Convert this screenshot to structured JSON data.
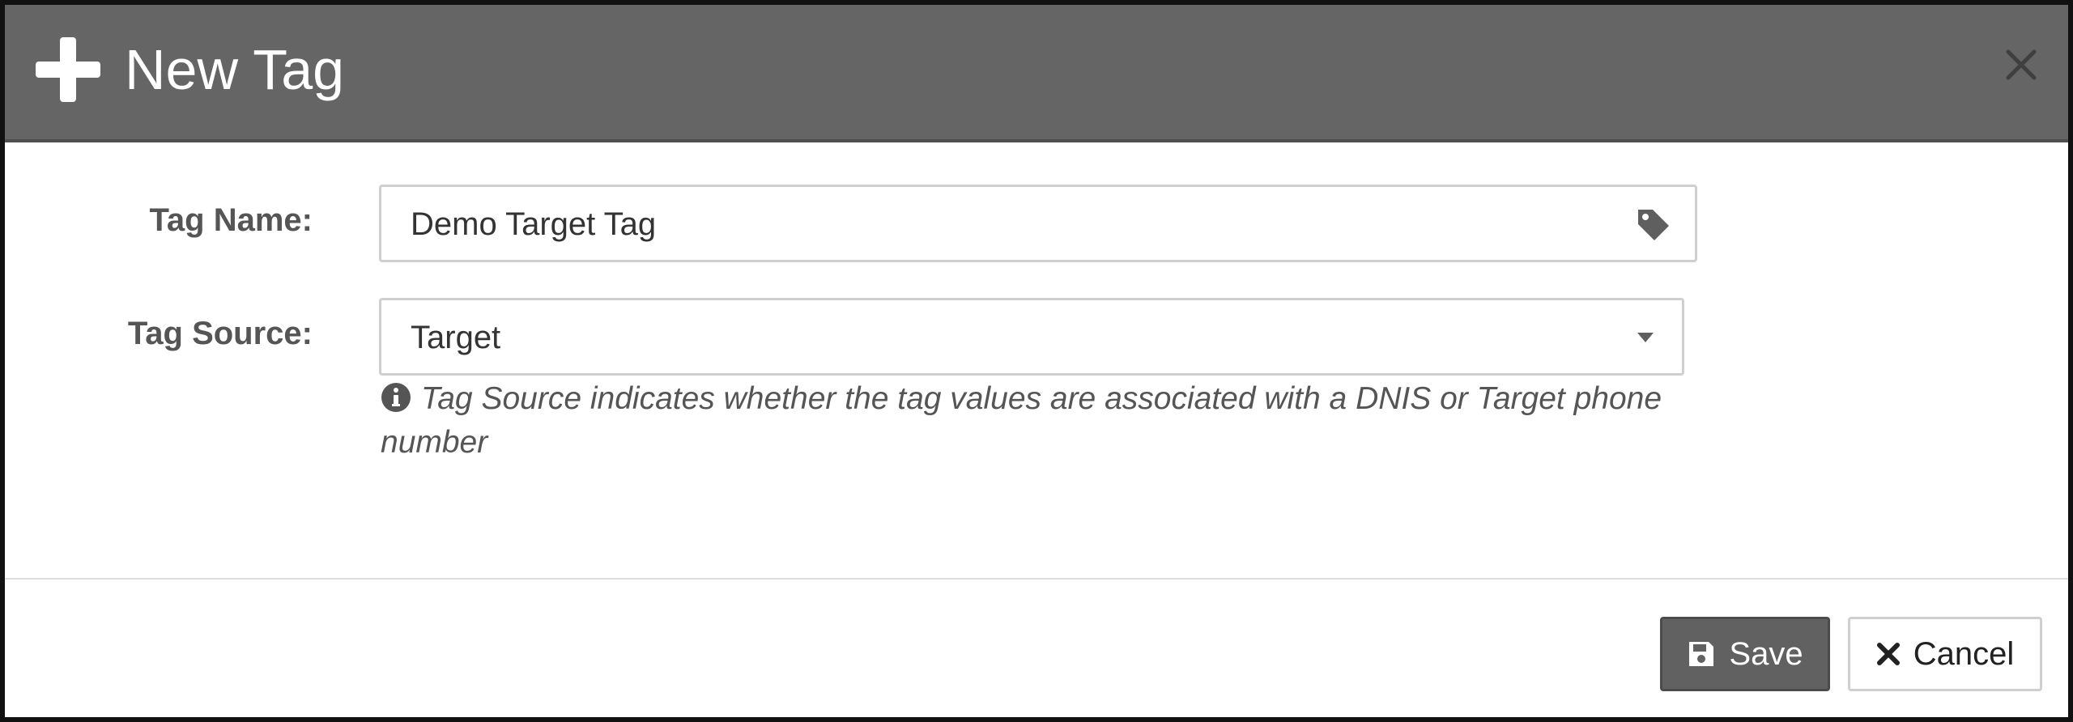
{
  "dialog": {
    "title": "New Tag",
    "icons": {
      "header": "plus-icon",
      "close": "close-icon"
    }
  },
  "form": {
    "tag_name": {
      "label": "Tag Name:",
      "value": "Demo Target Tag",
      "icon": "tag-icon"
    },
    "tag_source": {
      "label": "Tag Source:",
      "selected": "Target",
      "icon": "chevron-down-icon",
      "help_text": "Tag Source indicates whether the tag values are associated with a DNIS or Target phone number",
      "help_icon": "info-icon"
    }
  },
  "footer": {
    "save_label": "Save",
    "save_icon": "save-icon",
    "cancel_label": "Cancel",
    "cancel_icon": "times-icon"
  },
  "colors": {
    "header_bg": "#656565",
    "save_button_bg": "#616161"
  }
}
